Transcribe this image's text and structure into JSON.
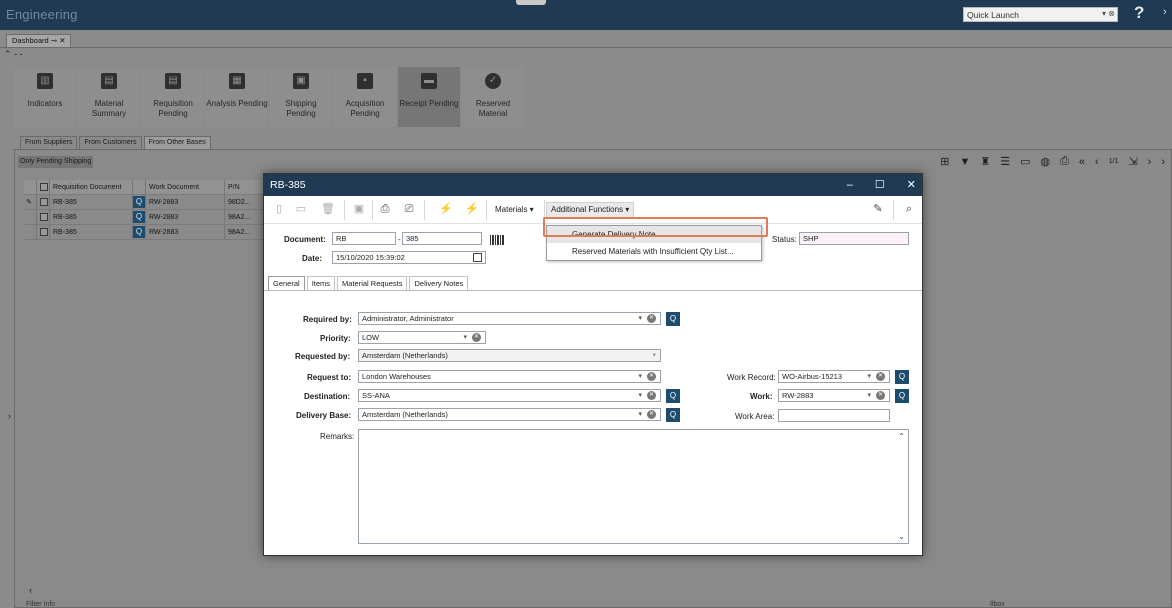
{
  "app": {
    "title": "Engineering",
    "quick_launch_placeholder": "Quick Launch",
    "help": "?"
  },
  "document_tab": {
    "label": "Dashboard",
    "pin": "⊸",
    "close": "✕"
  },
  "tiles": [
    {
      "label": "Indicators",
      "icon": "chart-icon"
    },
    {
      "label": "Material Summary",
      "icon": "document-icon"
    },
    {
      "label": "Requisition Pending",
      "icon": "requisition-icon"
    },
    {
      "label": "Analysis Pending",
      "icon": "analysis-icon"
    },
    {
      "label": "Shipping Pending",
      "icon": "shipping-icon"
    },
    {
      "label": "Acquisition Pending",
      "icon": "briefcase-icon"
    },
    {
      "label": "Receipt Pending",
      "icon": "truck-icon"
    },
    {
      "label": "Reserved Material",
      "icon": "check-circle-icon"
    }
  ],
  "subtabs": [
    "From Suppliers",
    "From Customers",
    "From Other Bases"
  ],
  "only_pending": "Only Pending Shipping",
  "grid": {
    "headers": [
      "Requisition Document",
      "Work Document",
      "P/N"
    ],
    "rows": [
      {
        "req": "RB-385",
        "work": "RW-2883",
        "pn": "98D2..."
      },
      {
        "req": "RB-385",
        "work": "RW-2883",
        "pn": "98A2..."
      },
      {
        "req": "RB-385",
        "work": "RW-2883",
        "pn": "98A2..."
      }
    ]
  },
  "pager": {
    "page": "1/1"
  },
  "modal": {
    "title": "RB-385",
    "menus": {
      "materials": "Materials ▾",
      "additional": "Additional Functions ▾"
    },
    "dropdown": [
      "Generate Delivery Note",
      "Reserved Materials with Insufficient Qty List..."
    ],
    "labels": {
      "document": "Document:",
      "date": "Date:",
      "status": "Status:",
      "required_by": "Required by:",
      "priority": "Priority:",
      "requested_by": "Requested by:",
      "request_to": "Request to:",
      "destination": "Destination:",
      "delivery_base": "Delivery Base:",
      "remarks": "Remarks:",
      "work_record": "Work Record:",
      "work": "Work:",
      "work_area": "Work Area:"
    },
    "values": {
      "doc_prefix": "RB",
      "doc_dash": "-",
      "doc_number": "385",
      "date": "15/10/2020 15:39:02",
      "status": "SHP",
      "required_by": "Administrator, Administrator",
      "priority": "LOW",
      "requested_by": "Amsterdam (Netherlands)",
      "request_to": "London Warehouses",
      "destination": "SS-ANA",
      "delivery_base": "Amsterdam (Netherlands)",
      "work_record": "WO-Airbus-15213",
      "work": "RW-2883",
      "work_area": ""
    },
    "tabs": [
      "General",
      "Items",
      "Material Requests",
      "Delivery Notes"
    ]
  },
  "footer": {
    "left": "Filter Info",
    "right": "Ilbox"
  },
  "colors": {
    "titlebar": "#1f3a52",
    "search_button": "#1d4c6c",
    "highlight": "#e07b53"
  }
}
